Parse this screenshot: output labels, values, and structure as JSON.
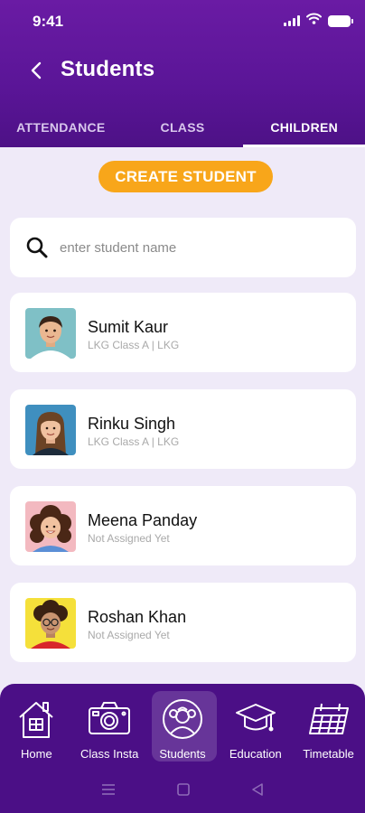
{
  "status_bar": {
    "time": "9:41"
  },
  "header": {
    "title": "Students"
  },
  "tabs": [
    {
      "label": "ATTENDANCE",
      "active": false
    },
    {
      "label": "CLASS",
      "active": false
    },
    {
      "label": "CHILDREN",
      "active": true
    }
  ],
  "create_button": {
    "label": "CREATE STUDENT"
  },
  "search": {
    "placeholder": "enter student name",
    "value": ""
  },
  "students": [
    {
      "name": "Sumit Kaur",
      "detail": "LKG Class A | LKG",
      "avatar_bg": "#7fc0c6",
      "shirt": "#ffffff",
      "hair": "#3a2418"
    },
    {
      "name": "Rinku Singh",
      "detail": "LKG Class A | LKG",
      "avatar_bg": "#3f8fbf",
      "shirt": "#1d2b3a",
      "hair": "#6b4325"
    },
    {
      "name": "Meena Panday",
      "detail": "Not Assigned Yet",
      "avatar_bg": "#f3b9c0",
      "shirt": "#5b8fd6",
      "hair": "#4a2716"
    },
    {
      "name": "Roshan Khan",
      "detail": "Not Assigned Yet",
      "avatar_bg": "#f5e03a",
      "shirt": "#d8262b",
      "hair": "#3a2112"
    }
  ],
  "bottom_nav": [
    {
      "label": "Home",
      "icon": "home-icon",
      "active": false
    },
    {
      "label": "Class Insta",
      "icon": "camera-icon",
      "active": false
    },
    {
      "label": "Students",
      "icon": "students-icon",
      "active": true
    },
    {
      "label": "Education",
      "icon": "graduation-cap-icon",
      "active": false
    },
    {
      "label": "Timetable",
      "icon": "calendar-icon",
      "active": false
    }
  ],
  "colors": {
    "header": "#5a1597",
    "accent": "#f8a61a",
    "background": "#efeaf8",
    "nav": "#4b0f86"
  }
}
